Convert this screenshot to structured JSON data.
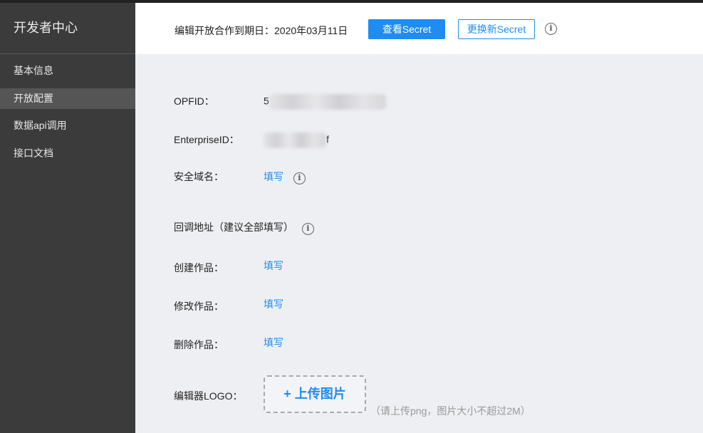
{
  "sidebar": {
    "title": "开发者中心",
    "items": [
      {
        "label": "基本信息",
        "active": false
      },
      {
        "label": "开放配置",
        "active": true
      },
      {
        "label": "数据api调用",
        "active": false
      },
      {
        "label": "接口文档",
        "active": false
      }
    ]
  },
  "header": {
    "deadline": "编辑开放合作到期日：2020年03月11日",
    "view_secret_label": "查看Secret",
    "reset_secret_label": "更换新Secret",
    "info_icon": "i"
  },
  "form": {
    "opfid": {
      "label": "OPFID：",
      "value_prefix": "5",
      "value_suffix": ""
    },
    "enterprise_id": {
      "label": "EnterpriseID：",
      "value_prefix": "",
      "value_suffix": "f"
    },
    "safe_domain": {
      "label": "安全域名：",
      "action": "填写"
    },
    "callback_header": {
      "label": "回调地址（建议全部填写）"
    },
    "create_work": {
      "label": "创建作品：",
      "action": "填写"
    },
    "modify_work": {
      "label": "修改作品：",
      "action": "填写"
    },
    "delete_work": {
      "label": "删除作品：",
      "action": "填写"
    },
    "editor_logo": {
      "label": "编辑器LOGO：",
      "upload_label": "+ 上传图片",
      "hint": "（请上传png，图片大小不超过2M）"
    }
  },
  "colors": {
    "accent": "#1e8cf0",
    "sidebar_bg": "#3b3b3b",
    "sidebar_active": "#555555",
    "content_bg": "#eeeff3"
  }
}
